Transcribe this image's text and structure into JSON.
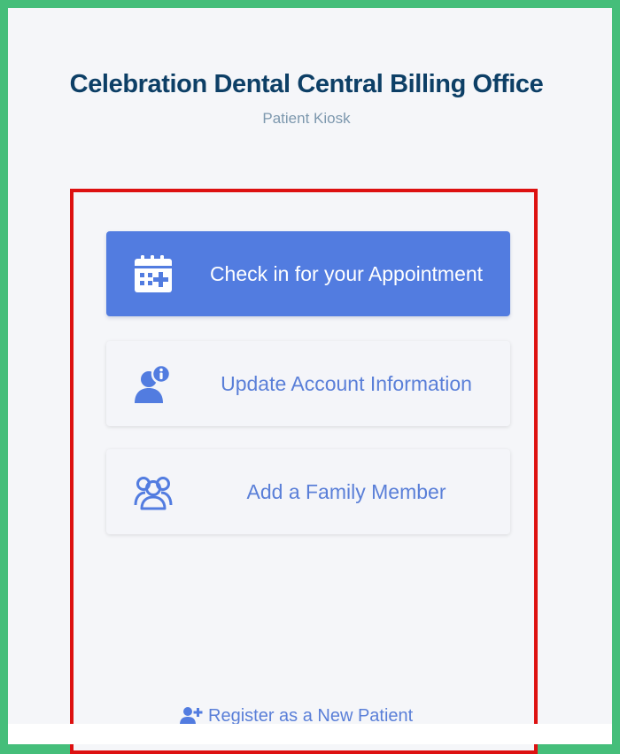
{
  "header": {
    "title": "Celebration Dental Central Billing Office",
    "subtitle": "Patient Kiosk"
  },
  "actions": [
    {
      "label": "Check in for your Appointment",
      "icon": "calendar-plus-icon",
      "style": "primary"
    },
    {
      "label": "Update Account Information",
      "icon": "user-info-icon",
      "style": "secondary"
    },
    {
      "label": "Add a Family Member",
      "icon": "users-icon",
      "style": "secondary"
    }
  ],
  "register": {
    "label": "Register as a New Patient",
    "icon": "user-plus-icon"
  },
  "colors": {
    "primary": "#527ce0",
    "title": "#0d3f66",
    "subtitle": "#7d98ae",
    "link": "#5a7fd8",
    "panel_border": "#dd1111",
    "frame": "#45be7a"
  }
}
